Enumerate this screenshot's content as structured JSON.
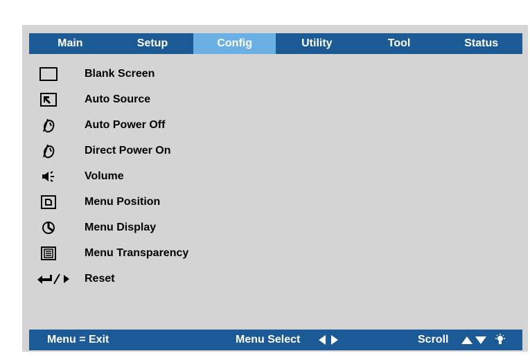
{
  "tabs": [
    {
      "label": "Main",
      "active": false
    },
    {
      "label": "Setup",
      "active": false
    },
    {
      "label": "Config",
      "active": true
    },
    {
      "label": "Utility",
      "active": false
    },
    {
      "label": "Tool",
      "active": false
    },
    {
      "label": "Status",
      "active": false
    }
  ],
  "menu": {
    "items": [
      {
        "label": "Blank Screen",
        "icon": "blank-screen-icon"
      },
      {
        "label": "Auto Source",
        "icon": "auto-source-icon"
      },
      {
        "label": "Auto Power Off",
        "icon": "power-off-icon"
      },
      {
        "label": "Direct Power On",
        "icon": "power-on-icon"
      },
      {
        "label": "Volume",
        "icon": "speaker-icon"
      },
      {
        "label": "Menu Position",
        "icon": "menu-position-icon"
      },
      {
        "label": "Menu Display",
        "icon": "menu-display-icon"
      },
      {
        "label": "Menu Transparency",
        "icon": "menu-transparency-icon"
      },
      {
        "label": "Reset",
        "icon": "enter-right-icon"
      }
    ]
  },
  "footer": {
    "exit_label": "Menu = Exit",
    "select_label": "Menu Select",
    "scroll_label": "Scroll"
  },
  "colors": {
    "bar": "#1c5a96",
    "active_tab": "#6ab0e4",
    "panel": "#d4d4d4"
  }
}
